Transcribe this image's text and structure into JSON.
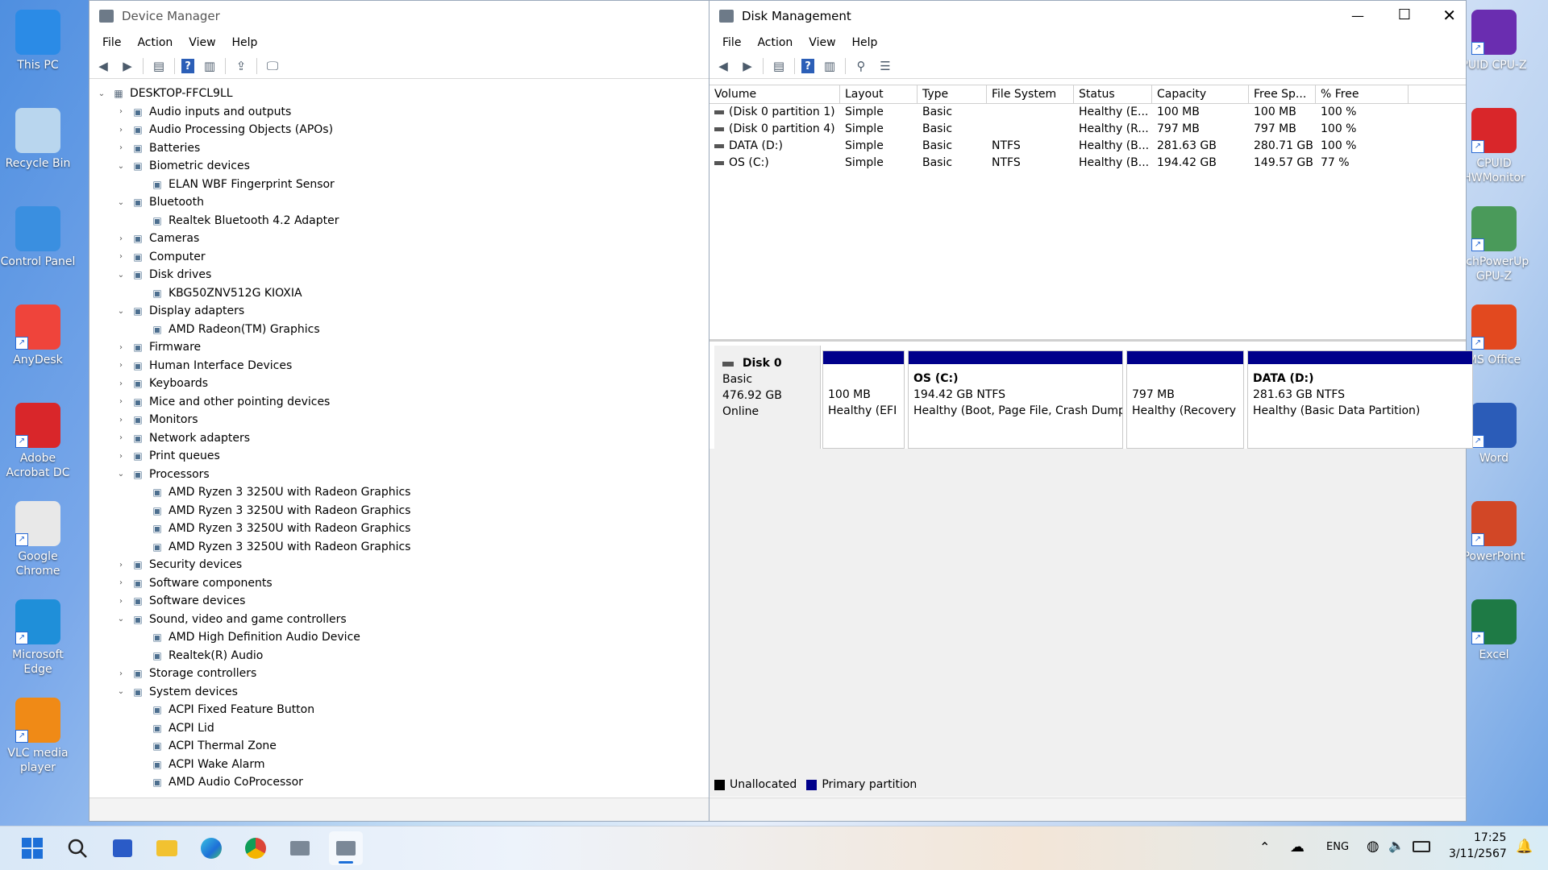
{
  "desktop_left": [
    {
      "label": "This PC",
      "icon": "monitor-icon"
    },
    {
      "label": "Recycle Bin",
      "icon": "recycle-bin-icon"
    },
    {
      "label": "Control Panel",
      "icon": "control-panel-icon"
    },
    {
      "label": "AnyDesk",
      "icon": "anydesk-icon"
    },
    {
      "label": "Adobe Acrobat DC",
      "icon": "acrobat-icon"
    },
    {
      "label": "Google Chrome",
      "icon": "chrome-icon"
    },
    {
      "label": "Microsoft Edge",
      "icon": "edge-icon"
    },
    {
      "label": "VLC media player",
      "icon": "vlc-icon"
    }
  ],
  "desktop_right": [
    {
      "label": "PUID CPU-Z",
      "icon": "cpuz-icon"
    },
    {
      "label": "CPUID HWMonitor",
      "icon": "hwmonitor-icon"
    },
    {
      "label": "echPowerUp GPU-Z",
      "icon": "gpuz-icon"
    },
    {
      "label": "MS Office",
      "icon": "office-icon"
    },
    {
      "label": "Word",
      "icon": "word-icon"
    },
    {
      "label": "PowerPoint",
      "icon": "powerpoint-icon"
    },
    {
      "label": "Excel",
      "icon": "excel-icon"
    }
  ],
  "device_manager": {
    "title": "Device Manager",
    "menu": [
      "File",
      "Action",
      "View",
      "Help"
    ],
    "root": "DESKTOP-FFCL9LL",
    "items": [
      {
        "label": "Audio inputs and outputs",
        "level": 1,
        "exp": "c"
      },
      {
        "label": "Audio Processing Objects (APOs)",
        "level": 1,
        "exp": "c"
      },
      {
        "label": "Batteries",
        "level": 1,
        "exp": "c"
      },
      {
        "label": "Biometric devices",
        "level": 1,
        "exp": "e"
      },
      {
        "label": "ELAN WBF Fingerprint Sensor",
        "level": 2,
        "exp": ""
      },
      {
        "label": "Bluetooth",
        "level": 1,
        "exp": "e"
      },
      {
        "label": "Realtek Bluetooth 4.2 Adapter",
        "level": 2,
        "exp": ""
      },
      {
        "label": "Cameras",
        "level": 1,
        "exp": "c"
      },
      {
        "label": "Computer",
        "level": 1,
        "exp": "c"
      },
      {
        "label": "Disk drives",
        "level": 1,
        "exp": "e"
      },
      {
        "label": "KBG50ZNV512G KIOXIA",
        "level": 2,
        "exp": ""
      },
      {
        "label": "Display adapters",
        "level": 1,
        "exp": "e"
      },
      {
        "label": "AMD Radeon(TM) Graphics",
        "level": 2,
        "exp": ""
      },
      {
        "label": "Firmware",
        "level": 1,
        "exp": "c"
      },
      {
        "label": "Human Interface Devices",
        "level": 1,
        "exp": "c"
      },
      {
        "label": "Keyboards",
        "level": 1,
        "exp": "c"
      },
      {
        "label": "Mice and other pointing devices",
        "level": 1,
        "exp": "c"
      },
      {
        "label": "Monitors",
        "level": 1,
        "exp": "c"
      },
      {
        "label": "Network adapters",
        "level": 1,
        "exp": "c"
      },
      {
        "label": "Print queues",
        "level": 1,
        "exp": "c"
      },
      {
        "label": "Processors",
        "level": 1,
        "exp": "e"
      },
      {
        "label": "AMD Ryzen 3 3250U with Radeon Graphics",
        "level": 2,
        "exp": ""
      },
      {
        "label": "AMD Ryzen 3 3250U with Radeon Graphics",
        "level": 2,
        "exp": ""
      },
      {
        "label": "AMD Ryzen 3 3250U with Radeon Graphics",
        "level": 2,
        "exp": ""
      },
      {
        "label": "AMD Ryzen 3 3250U with Radeon Graphics",
        "level": 2,
        "exp": ""
      },
      {
        "label": "Security devices",
        "level": 1,
        "exp": "c"
      },
      {
        "label": "Software components",
        "level": 1,
        "exp": "c"
      },
      {
        "label": "Software devices",
        "level": 1,
        "exp": "c"
      },
      {
        "label": "Sound, video and game controllers",
        "level": 1,
        "exp": "e"
      },
      {
        "label": "AMD High Definition Audio Device",
        "level": 2,
        "exp": ""
      },
      {
        "label": "Realtek(R) Audio",
        "level": 2,
        "exp": ""
      },
      {
        "label": "Storage controllers",
        "level": 1,
        "exp": "c"
      },
      {
        "label": "System devices",
        "level": 1,
        "exp": "e"
      },
      {
        "label": "ACPI Fixed Feature Button",
        "level": 2,
        "exp": ""
      },
      {
        "label": "ACPI Lid",
        "level": 2,
        "exp": ""
      },
      {
        "label": "ACPI Thermal Zone",
        "level": 2,
        "exp": ""
      },
      {
        "label": "ACPI Wake Alarm",
        "level": 2,
        "exp": ""
      },
      {
        "label": "AMD Audio CoProcessor",
        "level": 2,
        "exp": ""
      }
    ]
  },
  "disk_management": {
    "title": "Disk Management",
    "menu": [
      "File",
      "Action",
      "View",
      "Help"
    ],
    "columns": [
      "Volume",
      "Layout",
      "Type",
      "File System",
      "Status",
      "Capacity",
      "Free Sp...",
      "% Free"
    ],
    "rows": [
      [
        "(Disk 0 partition 1)",
        "Simple",
        "Basic",
        "",
        "Healthy (E...",
        "100 MB",
        "100 MB",
        "100 %"
      ],
      [
        "(Disk 0 partition 4)",
        "Simple",
        "Basic",
        "",
        "Healthy (R...",
        "797 MB",
        "797 MB",
        "100 %"
      ],
      [
        "DATA (D:)",
        "Simple",
        "Basic",
        "NTFS",
        "Healthy (B...",
        "281.63 GB",
        "280.71 GB",
        "100 %"
      ],
      [
        "OS (C:)",
        "Simple",
        "Basic",
        "NTFS",
        "Healthy (B...",
        "194.42 GB",
        "149.57 GB",
        "77 %"
      ]
    ],
    "disk": {
      "name": "Disk 0",
      "type": "Basic",
      "size": "476.92 GB",
      "state": "Online"
    },
    "partitions": [
      {
        "title": "",
        "line1": "100 MB",
        "line2": "Healthy (EFI"
      },
      {
        "title": "OS  (C:)",
        "line1": "194.42 GB NTFS",
        "line2": "Healthy (Boot, Page File, Crash Dump"
      },
      {
        "title": "",
        "line1": "797 MB",
        "line2": "Healthy (Recovery"
      },
      {
        "title": "DATA  (D:)",
        "line1": "281.63 GB NTFS",
        "line2": "Healthy (Basic Data Partition)"
      }
    ],
    "legend": [
      {
        "label": "Unallocated",
        "color": "#000000"
      },
      {
        "label": "Primary partition",
        "color": "#00008b"
      }
    ]
  },
  "taskbar": {
    "lang": "ENG",
    "time": "17:25",
    "date": "3/11/2567"
  },
  "colors": {
    "partition_band": "#00008b",
    "accent": "#2c5fb7"
  }
}
